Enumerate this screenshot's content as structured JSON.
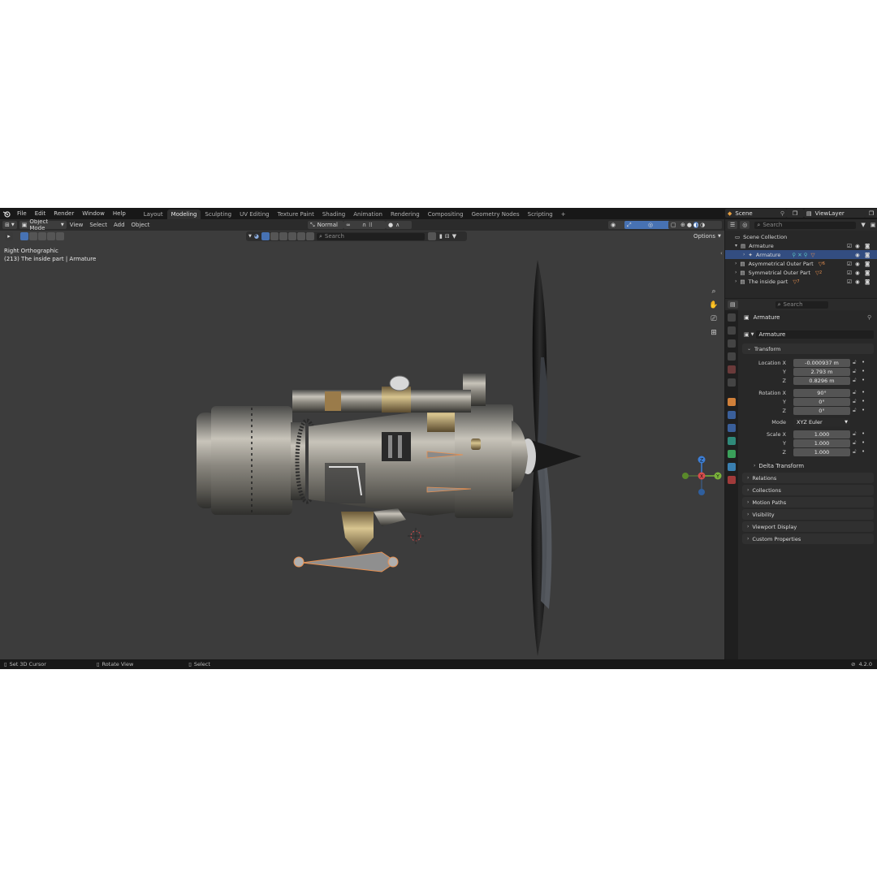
{
  "topbar": {
    "menus": [
      "File",
      "Edit",
      "Render",
      "Window",
      "Help"
    ],
    "workspaces": [
      "Layout",
      "Modeling",
      "Sculpting",
      "UV Editing",
      "Texture Paint",
      "Shading",
      "Animation",
      "Rendering",
      "Compositing",
      "Geometry Nodes",
      "Scripting"
    ],
    "active_workspace": "Modeling",
    "add_tab": "+",
    "scene": "Scene",
    "view_layer": "ViewLayer"
  },
  "viewport_header": {
    "mode": "Object Mode",
    "menus": [
      "View",
      "Select",
      "Add",
      "Object"
    ],
    "orientation": "Normal",
    "options": "Options",
    "search_placeholder": "Search"
  },
  "viewport": {
    "view_name": "Right Orthographic",
    "object_info": "(213) The inside part | Armature",
    "gizmo": {
      "z": "Z",
      "y": "Y",
      "x": "X"
    }
  },
  "outliner": {
    "search_placeholder": "Search",
    "scene_collection": "Scene Collection",
    "rows": [
      {
        "label": "Armature",
        "depth": 1,
        "expanded": true,
        "selected": false
      },
      {
        "label": "Armature",
        "depth": 2,
        "expanded": false,
        "selected": true
      },
      {
        "label": "Asymmetrical Outer Part",
        "depth": 1,
        "expanded": false,
        "selected": false,
        "badge": "6"
      },
      {
        "label": "Symmetrical Outer Part",
        "depth": 1,
        "expanded": false,
        "selected": false,
        "badge": "2"
      },
      {
        "label": "The inside part",
        "depth": 1,
        "expanded": false,
        "selected": false,
        "badge": "7"
      }
    ]
  },
  "properties": {
    "search_placeholder": "Search",
    "object_title": "Armature",
    "object_name": "Armature",
    "transform": {
      "header": "Transform",
      "location_label": "Location X",
      "location": {
        "x": "-0.000937 m",
        "y": "2.793 m",
        "z": "0.8296 m"
      },
      "rotation_label": "Rotation X",
      "rotation": {
        "x": "90°",
        "y": "0°",
        "z": "0°"
      },
      "mode_label": "Mode",
      "mode": "XYZ Euler",
      "scale_label": "Scale X",
      "scale": {
        "x": "1.000",
        "y": "1.000",
        "z": "1.000"
      },
      "axis_y": "Y",
      "axis_z": "Z"
    },
    "delta_transform": "Delta Transform",
    "panels": [
      "Relations",
      "Collections",
      "Motion Paths",
      "Visibility",
      "Viewport Display",
      "Custom Properties"
    ]
  },
  "statusbar": {
    "items": [
      "Set 3D Cursor",
      "Rotate View",
      "Select"
    ],
    "version": "4.2.0"
  },
  "colors": {
    "accent": "#4772b3",
    "selected_row": "#334d80",
    "viewport_bg": "#3c3c3c",
    "gizmo_x": "#d94c4c",
    "gizmo_y": "#7ab33a",
    "gizmo_z": "#3d7fd6"
  }
}
